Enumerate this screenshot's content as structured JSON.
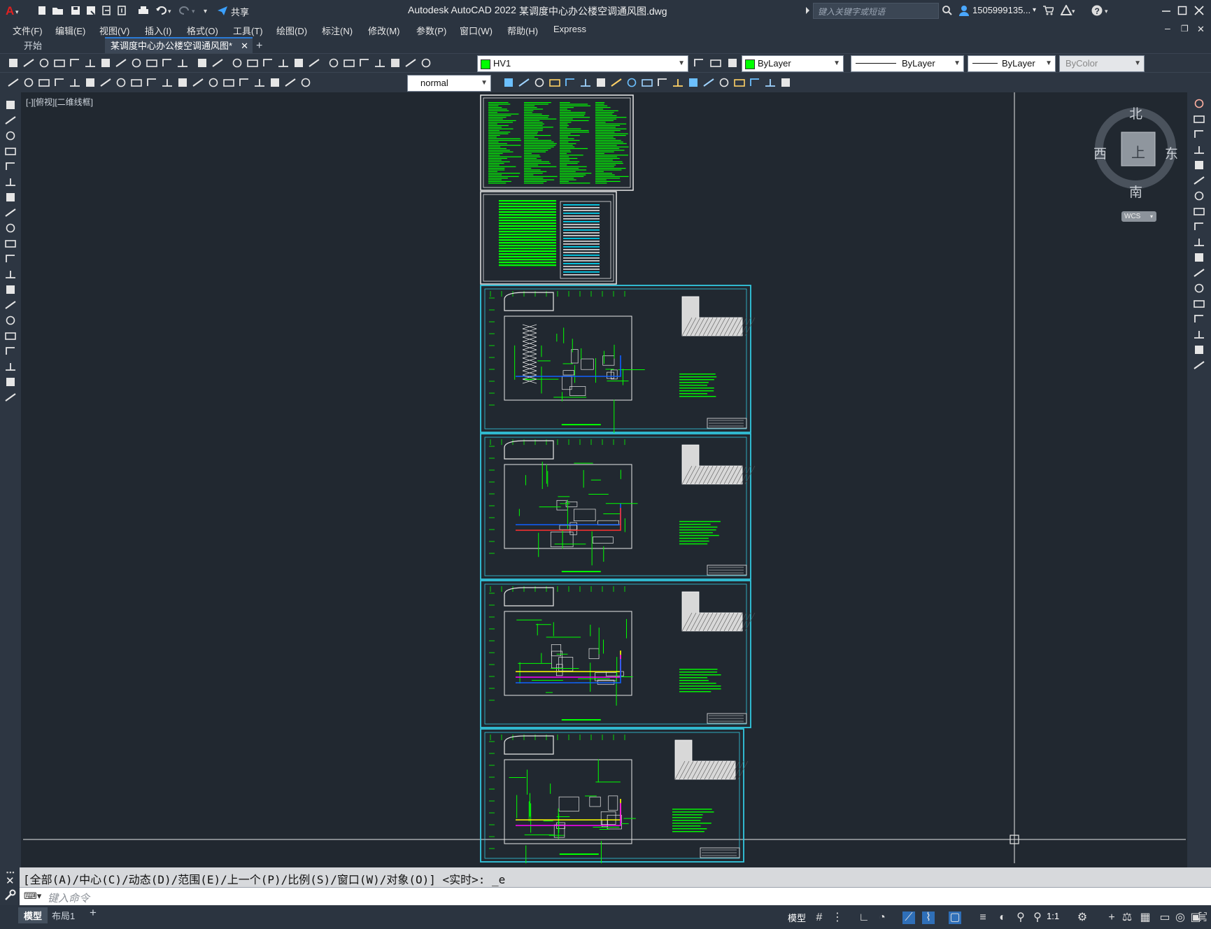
{
  "titlebar": {
    "app_title": "Autodesk AutoCAD 2022",
    "file_name": "某调度中心办公楼空调通风图.dwg",
    "share_label": "共享",
    "search_placeholder": "键入关键字或短语",
    "user_name": "1505999135..."
  },
  "menu": [
    "文件(F)",
    "编辑(E)",
    "视图(V)",
    "插入(I)",
    "格式(O)",
    "工具(T)",
    "绘图(D)",
    "标注(N)",
    "修改(M)",
    "参数(P)",
    "窗口(W)",
    "帮助(H)",
    "Express"
  ],
  "tabs": {
    "start": "开始",
    "active": "某调度中心办公楼空调通风图*"
  },
  "layers": {
    "current_layer": "HV1",
    "color": "ByLayer",
    "linetype": "ByLayer",
    "lineweight": "ByLayer",
    "plotstyle": "ByColor",
    "layer_color_hex": "#00ff00"
  },
  "toolbar2": {
    "dim_style": "normal"
  },
  "canvas": {
    "view_label": "[-][俯视][二维线框]"
  },
  "viewcube": {
    "north": "北",
    "south": "南",
    "east": "东",
    "west": "西",
    "top": "上",
    "wcs": "WCS"
  },
  "command": {
    "history": "[全部(A)/中心(C)/动态(D)/范围(E)/上一个(P)/比例(S)/窗口(W)/对象(O)] <实时>: _e",
    "placeholder": "键入命令"
  },
  "status": {
    "model_tab": "模型",
    "layout_tab": "布局1",
    "model_button": "模型",
    "scale": "1:1"
  },
  "colors": {
    "accent": "#00c0ff",
    "drawing_green": "#00ff00",
    "sheet_cyan": "#33c8e0",
    "magenta": "#ff00ff",
    "yellow": "#ffff00"
  }
}
